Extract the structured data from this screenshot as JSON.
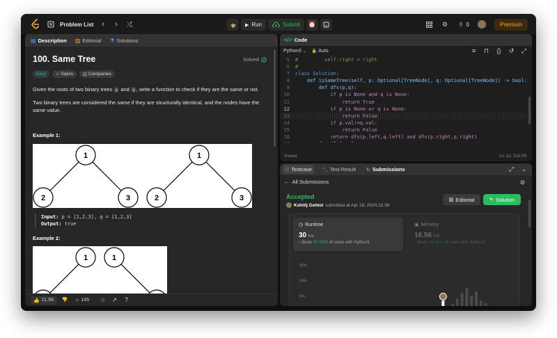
{
  "topbar": {
    "problem_list": "Problem List",
    "run_label": "Run",
    "submit_label": "Submit",
    "streak": "0",
    "premium_label": "Premium"
  },
  "left_tabs": [
    "Description",
    "Editorial",
    "Solutions"
  ],
  "problem": {
    "title": "100. Same Tree",
    "status": "Solved",
    "difficulty": "Easy",
    "topics_label": "Topics",
    "companies_label": "Companies",
    "desc1_pre": "Given the roots of two binary trees ",
    "desc1_p": "p",
    "desc1_mid": " and ",
    "desc1_q": "q",
    "desc1_post": ", write a function to check if they are the same or not.",
    "desc2": "Two binary trees are considered the same if they are structurally identical, and the nodes have the same value.",
    "example1_title": "Example 1:",
    "example1_input_label": "Input:",
    "example1_input": " p = [1,2,3], q = [1,2,3]",
    "example1_output_label": "Output:",
    "example1_output": " true",
    "example2_title": "Example 2:",
    "tree1_nodes": [
      "1",
      "2",
      "3"
    ],
    "tree2_nodes": [
      "1",
      "2",
      "3"
    ],
    "tree3_nodes": [
      "1",
      "1"
    ]
  },
  "footer": {
    "likes": "11.3K",
    "comments": "145"
  },
  "code_panel": {
    "title": "Code",
    "language": "Python3",
    "mode": "Auto",
    "status": "Saved",
    "cursor": "Ln 12, Col 29",
    "lines": [
      {
        "n": "5",
        "text": "#         self.right = right",
        "color": "#6a9955"
      },
      {
        "n": "6",
        "text": "#",
        "color": "#6a9955"
      },
      {
        "n": "7",
        "text": "class Solution:",
        "color": "#569cd6"
      },
      {
        "n": "8",
        "text": "    def isSameTree(self, p: Optional[TreeNode], q: Optional[TreeNode]) -> bool:",
        "color": "#79c0ff"
      },
      {
        "n": "9",
        "text": "        def dfs(p,q):",
        "color": "#79c0ff"
      },
      {
        "n": "10",
        "text": "            if p is None and q is None:",
        "color": "#c586c0"
      },
      {
        "n": "11",
        "text": "                return True",
        "color": "#c586c0"
      },
      {
        "n": "12",
        "text": "            if p is None or q is None:",
        "color": "#c586c0"
      },
      {
        "n": "13",
        "text": "                return False",
        "color": "#c586c0"
      },
      {
        "n": "14",
        "text": "            if p.val!=q.val:",
        "color": "#c586c0"
      },
      {
        "n": "15",
        "text": "                return False",
        "color": "#c586c0"
      },
      {
        "n": "16",
        "text": "            return dfs(p.left,q.left) and dfs(p.right,q.right)",
        "color": "#c586c0"
      },
      {
        "n": "17",
        "text": "        d = dfs(p,q)",
        "color": "#d4d4d4"
      },
      {
        "n": "18",
        "text": "        return d",
        "color": "#c586c0"
      }
    ]
  },
  "result_panel": {
    "tabs": [
      "Testcase",
      "Test Result",
      "Submissions"
    ],
    "all_submissions": "All Submissions",
    "accepted": "Accepted",
    "submitter": "Kshitij Gehlot",
    "submitted_at": "submitted at Apr 18, 2024 22:36",
    "editorial_btn": "Editorial",
    "solution_btn": "Solution",
    "runtime_label": "Runtime",
    "runtime_value": "30",
    "runtime_unit": "ms",
    "runtime_beats_pct": "87.02%",
    "runtime_beats_text": "of users with Python3",
    "memory_label": "Memory",
    "memory_value": "16.56",
    "memory_unit": "MB",
    "memory_beats_pct": "86.51%",
    "memory_beats_text": "of users with Python3",
    "beats_word": "Beats"
  },
  "chart_data": {
    "type": "bar",
    "ytick_labels": [
      "15%",
      "10%",
      "5%"
    ],
    "ylim": [
      0,
      17
    ],
    "values": [
      0.2,
      0.6,
      0.3,
      3.5,
      1.6,
      2.4,
      4.1,
      5.9,
      7.6,
      5.1,
      6.5,
      3.6,
      2.8,
      1.8,
      1.2
    ],
    "highlight_index": 3
  }
}
